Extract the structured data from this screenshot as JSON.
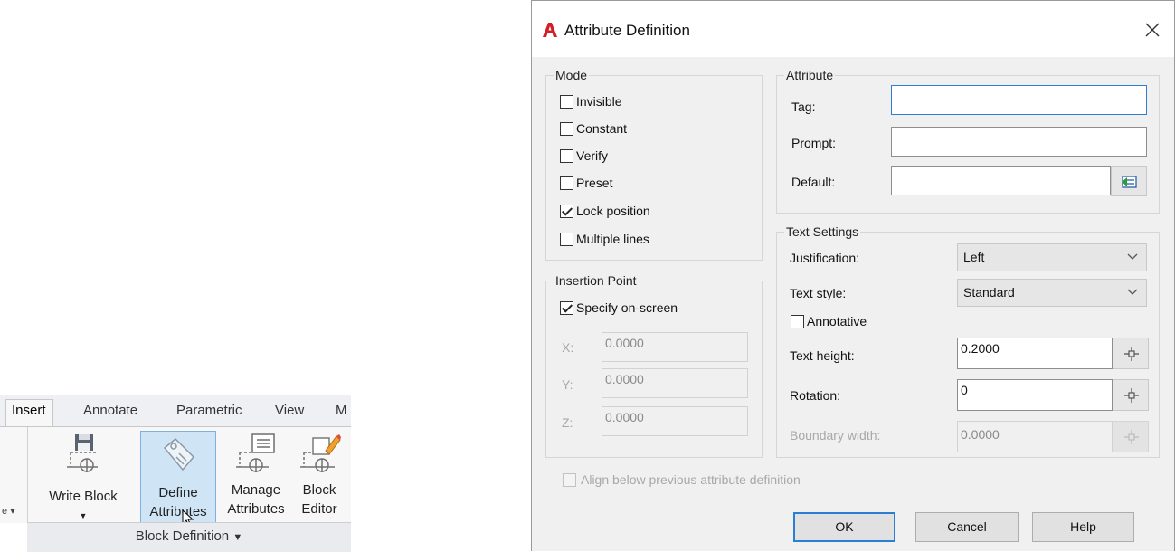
{
  "ribbon": {
    "tabs": [
      "Insert",
      "Annotate",
      "Parametric",
      "View",
      "M"
    ],
    "buttons": {
      "write_block": "Write Block",
      "define_attributes_line1": "Define",
      "define_attributes_line2": "Attributes",
      "manage_attributes_line1": "Manage",
      "manage_attributes_line2": "Attributes",
      "block_editor_line1": "Block",
      "block_editor_line2": "Editor"
    },
    "panel_title": "Block Definition",
    "panel_title_arrow": "▼",
    "left_edge_glyph": "e",
    "left_edge_arrow": "▾"
  },
  "dialog": {
    "title": "Attribute Definition",
    "logo_letter": "A",
    "close_glyph": "×",
    "mode": {
      "legend": "Mode",
      "invisible": "Invisible",
      "constant": "Constant",
      "verify": "Verify",
      "preset": "Preset",
      "lock_position": "Lock position",
      "multiple_lines": "Multiple lines"
    },
    "insertion_point": {
      "legend": "Insertion Point",
      "specify_on_screen": "Specify on-screen",
      "x_label": "X:",
      "x_value": "0.0000",
      "y_label": "Y:",
      "y_value": "0.0000",
      "z_label": "Z:",
      "z_value": "0.0000"
    },
    "attribute": {
      "legend": "Attribute",
      "tag_label": "Tag:",
      "tag_value": "",
      "prompt_label": "Prompt:",
      "prompt_value": "",
      "default_label": "Default:",
      "default_value": ""
    },
    "text_settings": {
      "legend": "Text Settings",
      "justification_label": "Justification:",
      "justification_value": "Left",
      "text_style_label": "Text style:",
      "text_style_value": "Standard",
      "annotative": "Annotative",
      "text_height_label": "Text height:",
      "text_height_value": "0.2000",
      "rotation_label": "Rotation:",
      "rotation_value": "0",
      "boundary_width_label": "Boundary width:",
      "boundary_width_value": "0.0000"
    },
    "align_below": "Align below previous attribute definition",
    "buttons": {
      "ok": "OK",
      "cancel": "Cancel",
      "help": "Help"
    }
  },
  "colors": {
    "logo_red": "#d21f26",
    "focus_blue": "#2a7fd4",
    "ribbon_selected": "#cfe5f6"
  }
}
